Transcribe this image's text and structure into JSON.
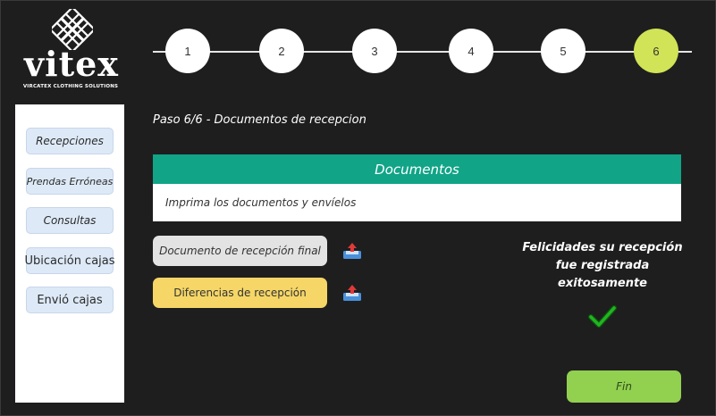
{
  "brand": {
    "name": "vitex",
    "tagline": "VIRCATEX CLOTHING SOLUTIONS"
  },
  "stepper": {
    "steps": [
      "1",
      "2",
      "3",
      "4",
      "5",
      "6"
    ],
    "current": 6,
    "active_color": "#d1e356"
  },
  "sidebar": {
    "items": [
      {
        "label": "Recepciones"
      },
      {
        "label": "Prendas Erróneas"
      },
      {
        "label": "Consultas"
      },
      {
        "label": "Ubicación cajas"
      },
      {
        "label": "Envió cajas"
      }
    ]
  },
  "main": {
    "title": "Paso 6/6 - Documentos de recepcion",
    "panel": {
      "header": "Documentos",
      "instruction": "Imprima los documentos y envíelos"
    },
    "documents": [
      {
        "label": "Documento de recepción final",
        "icon": "upload-icon"
      },
      {
        "label": "Diferencias de recepción",
        "icon": "upload-icon"
      }
    ],
    "success_message": [
      "Felicidades su recepción",
      "fue registrada",
      "exitosamente"
    ],
    "finish_button": "Fin"
  },
  "colors": {
    "header": "#11a487",
    "finish": "#92d050",
    "highlight": "#f5d667",
    "check": "#22a022"
  }
}
